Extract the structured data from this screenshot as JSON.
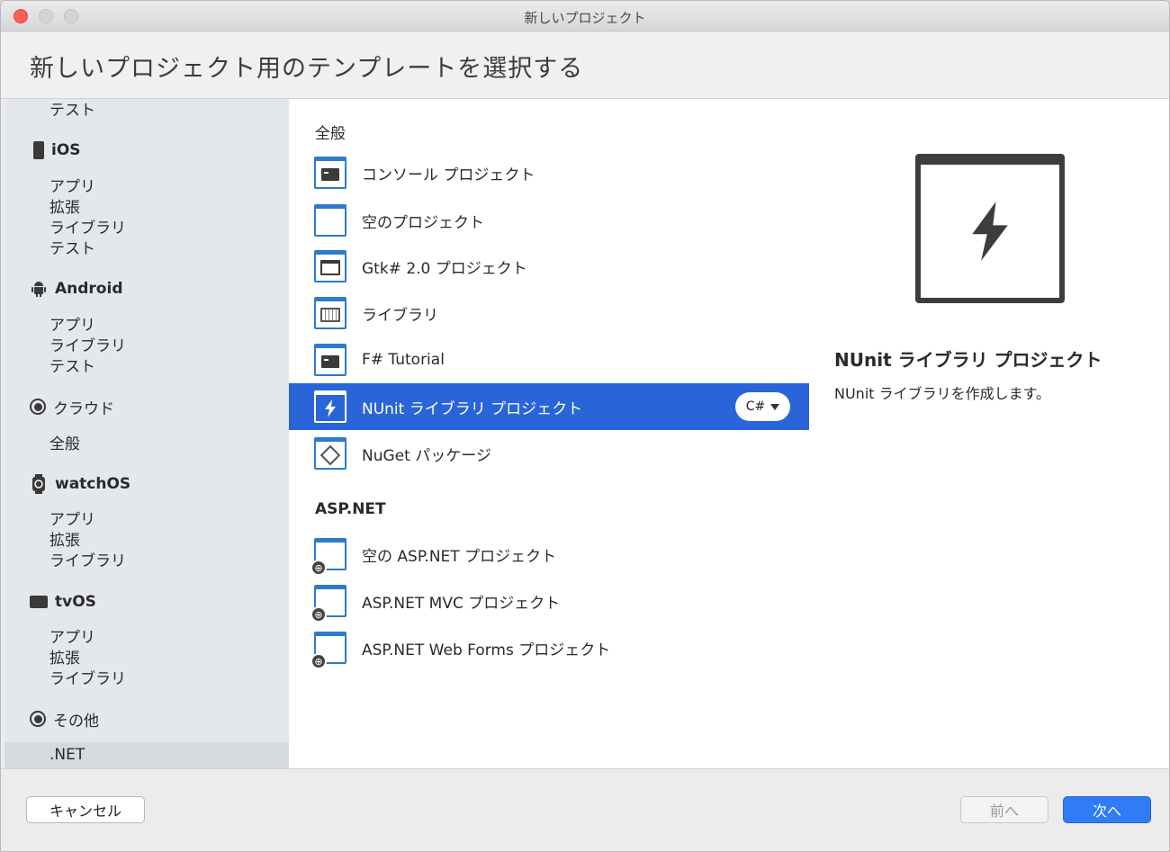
{
  "window": {
    "title": "新しいプロジェクト"
  },
  "header": {
    "title": "新しいプロジェクト用のテンプレートを選択する"
  },
  "sidebar": {
    "top_item": "テスト",
    "categories": [
      {
        "label": "iOS",
        "icon": "phone-icon",
        "items": [
          "アプリ",
          "拡張",
          "ライブラリ",
          "テスト"
        ]
      },
      {
        "label": "Android",
        "icon": "android-icon",
        "items": [
          "アプリ",
          "ライブラリ",
          "テスト"
        ]
      },
      {
        "label": "クラウド",
        "icon": "cloud-radio-icon",
        "items": [
          "全般"
        ]
      },
      {
        "label": "watchOS",
        "icon": "watch-icon",
        "items": [
          "アプリ",
          "拡張",
          "ライブラリ"
        ]
      },
      {
        "label": "tvOS",
        "icon": "tv-icon",
        "items": [
          "アプリ",
          "拡張",
          "ライブラリ"
        ]
      },
      {
        "label": "その他",
        "icon": "other-radio-icon",
        "items": [
          ".NET"
        ]
      }
    ],
    "selected": ".NET"
  },
  "templates": {
    "section_general": "全般",
    "general": [
      {
        "label": "コンソール プロジェクト",
        "icon": "terminal-icon"
      },
      {
        "label": "空のプロジェクト",
        "icon": "blank-icon"
      },
      {
        "label": "Gtk# 2.0 プロジェクト",
        "icon": "window-icon"
      },
      {
        "label": "ライブラリ",
        "icon": "library-icon"
      },
      {
        "label": "F# Tutorial",
        "icon": "terminal-icon"
      },
      {
        "label": "NUnit ライブラリ プロジェクト",
        "icon": "lightning-icon",
        "selected": true,
        "language": "C#"
      },
      {
        "label": "NuGet パッケージ",
        "icon": "package-icon"
      }
    ],
    "section_asp": "ASP.NET",
    "asp": [
      {
        "label": "空の ASP.NET プロジェクト",
        "icon": "globe-icon"
      },
      {
        "label": "ASP.NET MVC プロジェクト",
        "icon": "globe-icon"
      },
      {
        "label": "ASP.NET Web Forms プロジェクト",
        "icon": "globe-icon"
      }
    ]
  },
  "detail": {
    "title": "NUnit ライブラリ プロジェクト",
    "description": "NUnit ライブラリを作成します。",
    "icon": "lightning-icon"
  },
  "footer": {
    "cancel_label": "キャンセル",
    "prev_label": "前へ",
    "next_label": "次へ"
  },
  "colors": {
    "selection": "#2965d8",
    "accent_button": "#2f7cf6",
    "tile_border": "#2f7bc8"
  }
}
